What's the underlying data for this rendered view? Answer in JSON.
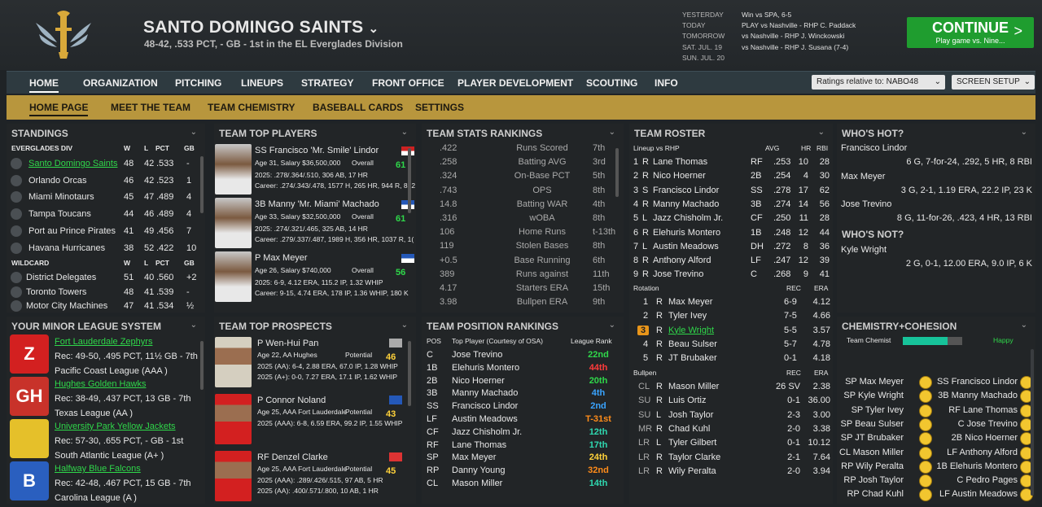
{
  "header": {
    "team_name": "SANTO DOMINGO SAINTS",
    "team_sub": "48-42, .533 PCT, - GB - 1st in the EL Everglades Division",
    "schedule": [
      {
        "day": "YESTERDAY",
        "game": "Win vs SPA, 6-5"
      },
      {
        "day": "TODAY",
        "game": "PLAY vs Nashville - RHP C. Paddack"
      },
      {
        "day": "TOMORROW",
        "game": "vs Nashville - RHP J. Winckowski"
      },
      {
        "day": "SAT. JUL. 19",
        "game": "vs Nashville - RHP J. Susana (7-4)"
      },
      {
        "day": "SUN. JUL. 20",
        "game": ""
      }
    ],
    "continue_label": "CONTINUE",
    "continue_sub": "Play game vs. Nine...",
    "continue_arrow": ">"
  },
  "nav": {
    "items": [
      "HOME",
      "ORGANIZATION",
      "PITCHING",
      "LINEUPS",
      "STRATEGY",
      "FRONT OFFICE",
      "PLAYER DEVELOPMENT",
      "SCOUTING",
      "INFO"
    ],
    "ratings": "Ratings relative to: NABO48",
    "screen_setup": "SCREEN SETUP"
  },
  "subnav": {
    "items": [
      "HOME PAGE",
      "MEET THE TEAM",
      "TEAM CHEMISTRY",
      "BASEBALL CARDS",
      "SETTINGS"
    ]
  },
  "standings": {
    "title": "STANDINGS",
    "div_name": "EVERGLADES DIV",
    "cols": [
      "W",
      "L",
      "PCT",
      "GB"
    ],
    "div_rows": [
      [
        "Santo Domingo Saints",
        "48",
        "42",
        ".533",
        "-"
      ],
      [
        "Orlando Orcas",
        "46",
        "42",
        ".523",
        "1"
      ],
      [
        "Miami Minotaurs",
        "45",
        "47",
        ".489",
        "4"
      ],
      [
        "Tampa Toucans",
        "44",
        "46",
        ".489",
        "4"
      ],
      [
        "Port au Prince Pirates",
        "41",
        "49",
        ".456",
        "7"
      ],
      [
        "Havana Hurricanes",
        "38",
        "52",
        ".422",
        "10"
      ]
    ],
    "wc_name": "WILDCARD",
    "wc_rows": [
      [
        "District Delegates",
        "51",
        "40",
        ".560",
        "+2"
      ],
      [
        "Toronto Towers",
        "48",
        "41",
        ".539",
        "-"
      ],
      [
        "Motor City Machines",
        "47",
        "41",
        ".534",
        "½"
      ]
    ]
  },
  "minors": {
    "title": "YOUR MINOR LEAGUE SYSTEM",
    "teams": [
      {
        "name": "Fort Lauderdale Zephyrs",
        "rec": "Rec: 49-50, .495 PCT, 11½ GB - 7th",
        "league": "Pacific Coast League (AAA )"
      },
      {
        "name": "Hughes Golden Hawks",
        "rec": "Rec: 38-49, .437 PCT, 13 GB - 7th",
        "league": "Texas League (AA )"
      },
      {
        "name": "University Park Yellow Jackets",
        "rec": "Rec: 57-30, .655 PCT, - GB - 1st",
        "league": "South Atlantic League (A+ )"
      },
      {
        "name": "Halfway Blue Falcons",
        "rec": "Rec: 42-48, .467 PCT, 15 GB - 7th",
        "league": "Carolina League (A )"
      }
    ],
    "logos": [
      "Z",
      "GH",
      "",
      "B"
    ]
  },
  "top_players": {
    "title": "TEAM TOP PLAYERS",
    "players": [
      {
        "name": "SS Francisco 'Mr. Smile' Lindor",
        "info": "Age 31, Salary $36,500,000",
        "ovl": "Overall",
        "rating": "61",
        "s1": "2025: .278/.364/.510, 306 AB, 17 HR",
        "s2": "Career: .274/.343/.478, 1577 H, 265 HR, 944 R, 832"
      },
      {
        "name": "3B Manny 'Mr. Miami' Machado",
        "info": "Age 33, Salary $32,500,000",
        "ovl": "Overall",
        "rating": "61",
        "s1": "2025: .274/.321/.465, 325 AB, 14 HR",
        "s2": "Career: .279/.337/.487, 1989 H, 356 HR, 1037 R, 1("
      },
      {
        "name": "P Max Meyer",
        "info": "Age 26, Salary $740,000",
        "ovl": "Overall",
        "rating": "56",
        "s1": "2025: 6-9, 4.12 ERA, 115.2 IP, 1.32 WHIP",
        "s2": "Career: 9-15, 4.74 ERA, 178 IP, 1.36 WHIP, 180 K"
      }
    ]
  },
  "prospects": {
    "title": "TEAM TOP PROSPECTS",
    "players": [
      {
        "name": "P Wen-Hui Pan",
        "info": "Age 22, AA Hughes",
        "pot": "Potential",
        "rating": "46",
        "s1": "2025 (AA): 6-4, 2.88 ERA, 67.0 IP, 1.28 WHIP",
        "s2": "2025 (A+): 0-0, 7.27 ERA, 17.1 IP, 1.62 WHIP"
      },
      {
        "name": "P Connor Noland",
        "info": "Age 25, AAA Fort Lauderdale",
        "pot": "Potential",
        "rating": "43",
        "s1": "2025 (AAA): 6-8, 6.59 ERA, 99.2 IP, 1.55 WHIP",
        "s2": ""
      },
      {
        "name": "RF Denzel Clarke",
        "info": "Age 25, AAA Fort Lauderdale",
        "pot": "Potential",
        "rating": "45",
        "s1": "2025 (AAA): .289/.426/.515, 97 AB, 5 HR",
        "s2": "2025 (AA): .400/.571/.800, 10 AB, 1 HR"
      }
    ]
  },
  "stats": {
    "title": "TEAM STATS RANKINGS",
    "rows": [
      [
        ".422",
        "Runs Scored",
        "7th"
      ],
      [
        ".258",
        "Batting AVG",
        "3rd"
      ],
      [
        ".324",
        "On-Base PCT",
        "5th"
      ],
      [
        ".743",
        "OPS",
        "8th"
      ],
      [
        "14.8",
        "Batting WAR",
        "4th"
      ],
      [
        ".316",
        "wOBA",
        "8th"
      ],
      [
        "106",
        "Home Runs",
        "t-13th"
      ],
      [
        "119",
        "Stolen Bases",
        "8th"
      ],
      [
        "+0.5",
        "Base Running",
        "6th"
      ],
      [
        "389",
        "Runs against",
        "11th"
      ],
      [
        "4.17",
        "Starters ERA",
        "15th"
      ],
      [
        "3.98",
        "Bullpen ERA",
        "9th"
      ]
    ]
  },
  "positions": {
    "title": "TEAM POSITION RANKINGS",
    "cols": [
      "POS",
      "Top Player (Courtesy of OSA)",
      "League Rank"
    ],
    "rows": [
      [
        "C",
        "Jose Trevino",
        "22nd"
      ],
      [
        "1B",
        "Elehuris Montero",
        "44th"
      ],
      [
        "2B",
        "Nico Hoerner",
        "20th"
      ],
      [
        "3B",
        "Manny Machado",
        "4th"
      ],
      [
        "SS",
        "Francisco Lindor",
        "2nd"
      ],
      [
        "LF",
        "Austin Meadows",
        "T-31st"
      ],
      [
        "CF",
        "Jazz Chisholm Jr.",
        "12th"
      ],
      [
        "RF",
        "Lane Thomas",
        "17th"
      ],
      [
        "SP",
        "Max Meyer",
        "24th"
      ],
      [
        "RP",
        "Danny Young",
        "32nd"
      ],
      [
        "CL",
        "Mason Miller",
        "14th"
      ]
    ],
    "rank_colors": [
      "#2fd84a",
      "#ff3b3b",
      "#2fd84a",
      "#3aa4ff",
      "#3aa4ff",
      "#ff8c1a",
      "#2fd8b0",
      "#2fd8b0",
      "#ffd23a",
      "#ff8c1a",
      "#2fd8b0"
    ]
  },
  "roster": {
    "title": "TEAM ROSTER",
    "lineup_label": "Lineup vs RHP",
    "lcols": [
      "AVG",
      "HR",
      "RBI"
    ],
    "lineup": [
      [
        "1",
        "R",
        "Lane Thomas",
        "RF",
        ".253",
        "10",
        "28"
      ],
      [
        "2",
        "R",
        "Nico Hoerner",
        "2B",
        ".254",
        "4",
        "30"
      ],
      [
        "3",
        "S",
        "Francisco Lindor",
        "SS",
        ".278",
        "17",
        "62"
      ],
      [
        "4",
        "R",
        "Manny Machado",
        "3B",
        ".274",
        "14",
        "56"
      ],
      [
        "5",
        "L",
        "Jazz Chisholm Jr.",
        "CF",
        ".250",
        "11",
        "28"
      ],
      [
        "6",
        "R",
        "Elehuris Montero",
        "1B",
        ".248",
        "12",
        "44"
      ],
      [
        "7",
        "L",
        "Austin Meadows",
        "DH",
        ".272",
        "8",
        "36"
      ],
      [
        "8",
        "R",
        "Anthony Alford",
        "LF",
        ".247",
        "12",
        "39"
      ],
      [
        "9",
        "R",
        "Jose Trevino",
        "C",
        ".268",
        "9",
        "41"
      ]
    ],
    "rot_label": "Rotation",
    "rcols": [
      "REC",
      "ERA"
    ],
    "rotation": [
      [
        "1",
        "R",
        "Max Meyer",
        "6-9",
        "4.12"
      ],
      [
        "2",
        "R",
        "Tyler Ivey",
        "7-5",
        "4.66"
      ],
      [
        "3",
        "R",
        "Kyle Wright",
        "5-5",
        "3.57"
      ],
      [
        "4",
        "R",
        "Beau Sulser",
        "5-7",
        "4.78"
      ],
      [
        "5",
        "R",
        "JT Brubaker",
        "0-1",
        "4.18"
      ]
    ],
    "bp_label": "Bullpen",
    "bullpen": [
      [
        "CL",
        "R",
        "Mason Miller",
        "26 SV",
        "2.38"
      ],
      [
        "SU",
        "R",
        "Luis Ortiz",
        "0-1",
        "36.00"
      ],
      [
        "SU",
        "L",
        "Josh Taylor",
        "2-3",
        "3.00"
      ],
      [
        "MR",
        "R",
        "Chad Kuhl",
        "2-0",
        "3.38"
      ],
      [
        "LR",
        "L",
        "Tyler Gilbert",
        "0-1",
        "10.12"
      ],
      [
        "LR",
        "R",
        "Taylor Clarke",
        "2-1",
        "7.64"
      ],
      [
        "LR",
        "R",
        "Wily Peralta",
        "2-0",
        "3.94"
      ]
    ]
  },
  "hot": {
    "title": "WHO'S HOT?",
    "rows": [
      [
        "Francisco Lindor",
        "6 G, 7-for-24, .292, 5 HR, 8 RBI"
      ],
      [
        "Max Meyer",
        "3 G, 2-1, 1.19 ERA, 22.2 IP, 23 K"
      ],
      [
        "Jose Trevino",
        "8 G, 11-for-26, .423, 4 HR, 13 RBI"
      ]
    ],
    "not_title": "WHO'S NOT?",
    "not_rows": [
      [
        "Kyle Wright",
        "2 G, 0-1, 12.00 ERA, 9.0 IP, 6 K"
      ]
    ]
  },
  "chem": {
    "title": "CHEMISTRY+COHESION",
    "label": "Team Chemist",
    "status": "Happy",
    "level": 0.75,
    "left": [
      "SP Max Meyer",
      "SP Kyle Wright",
      "SP Tyler Ivey",
      "SP Beau Sulser",
      "SP JT Brubaker",
      "CL Mason Miller",
      "RP Wily Peralta",
      "RP Josh Taylor",
      "RP Chad Kuhl"
    ],
    "right": [
      "SS Francisco Lindor",
      "3B Manny Machado",
      "RF Lane Thomas",
      "C Jose Trevino",
      "2B Nico Hoerner",
      "LF Anthony Alford",
      "1B Elehuris Montero",
      "C Pedro Pages",
      "LF Austin Meadows"
    ]
  }
}
